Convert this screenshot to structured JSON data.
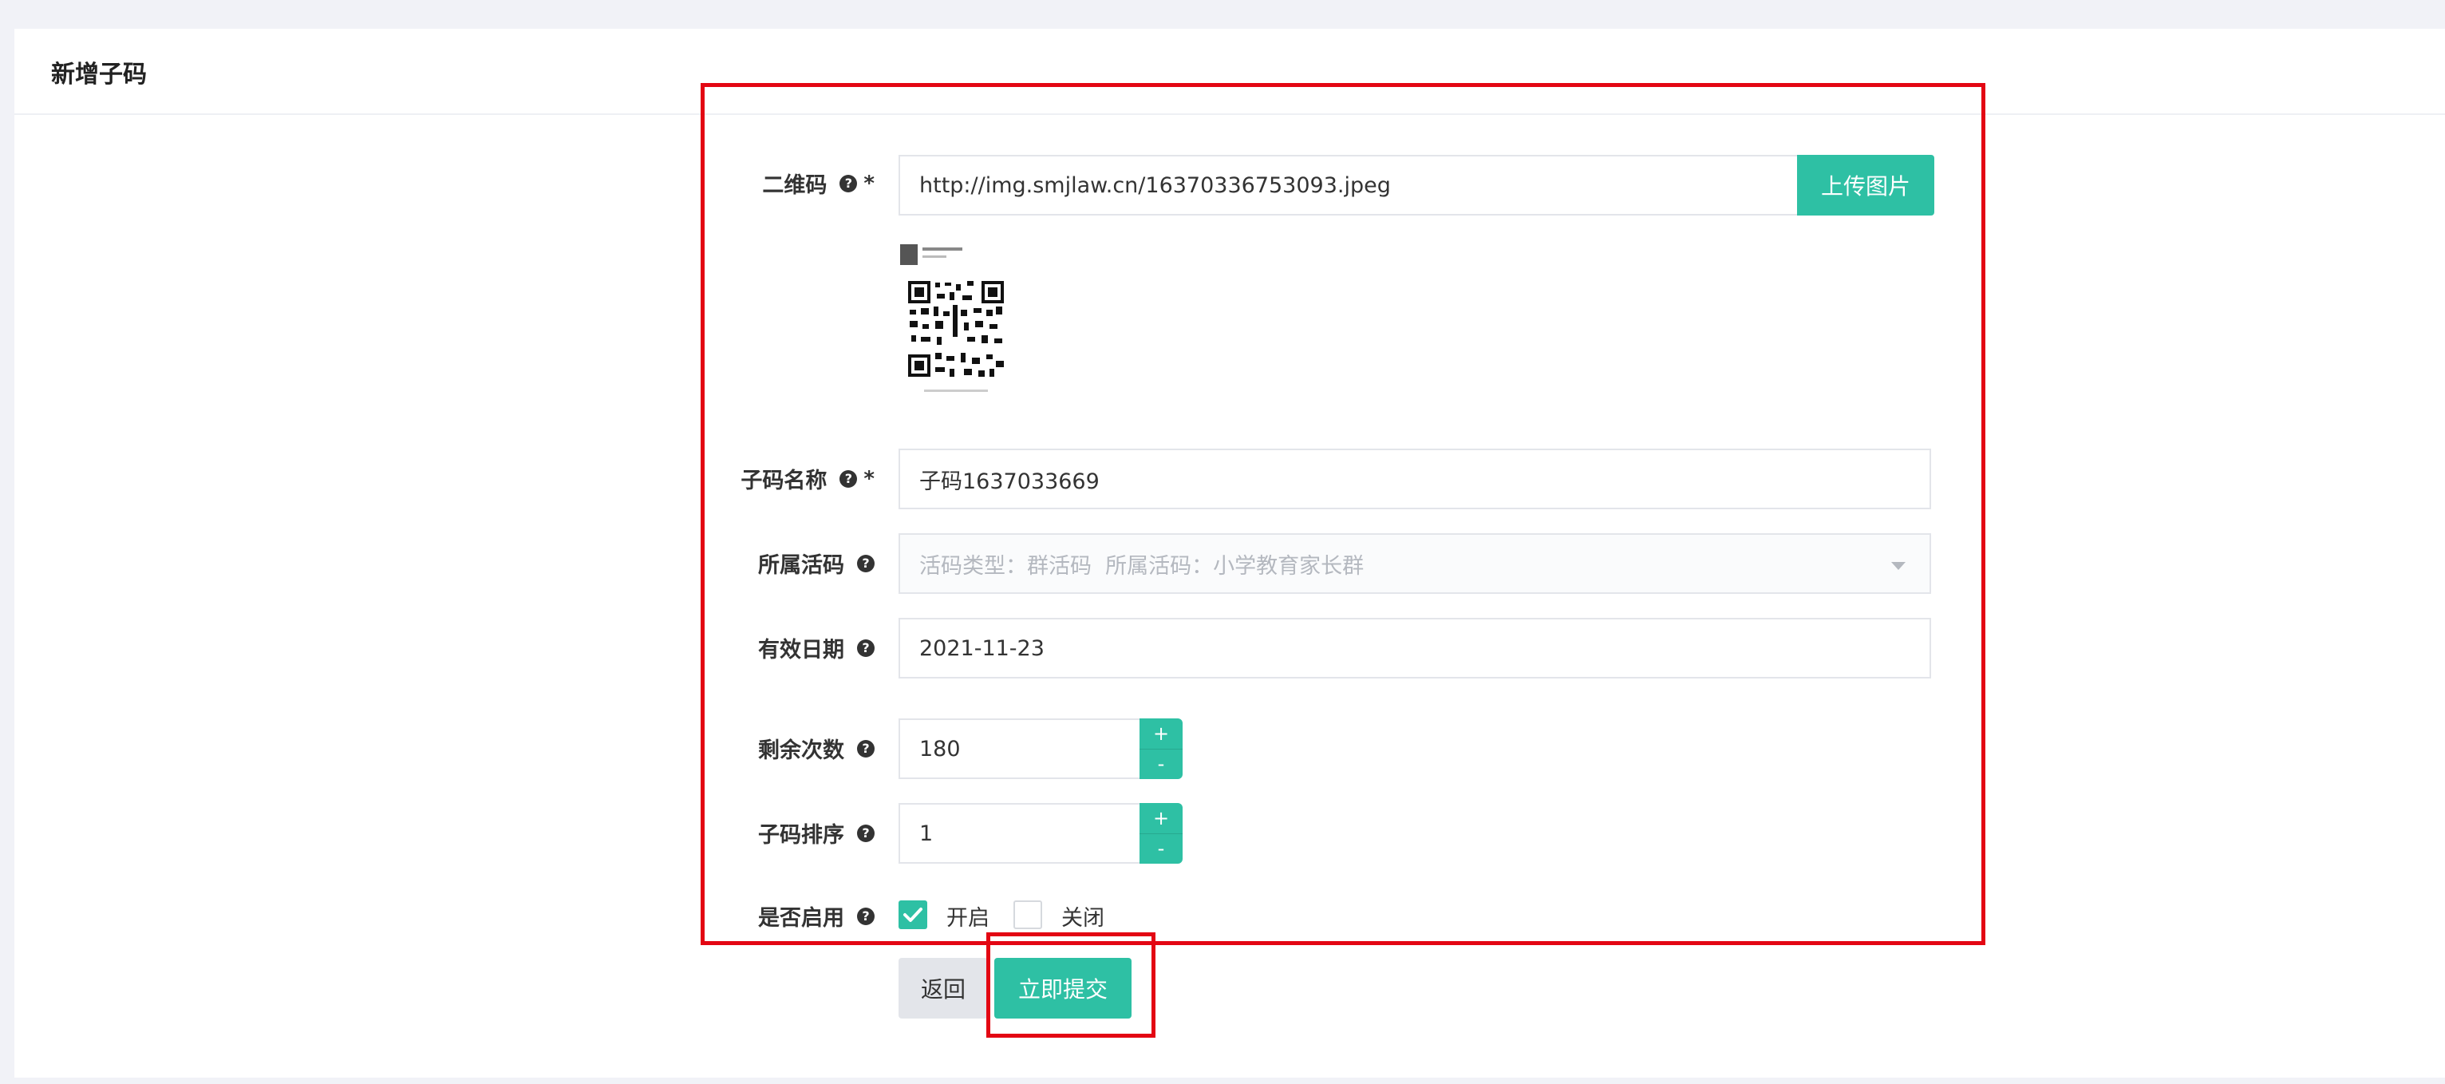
{
  "page": {
    "title": "新增子码"
  },
  "form": {
    "qrcode": {
      "label": "二维码",
      "help_icon": "question-circle-icon",
      "required_mark": "*",
      "value": "http://img.smjlaw.cn/16370336753093.jpeg",
      "upload_label": "上传图片"
    },
    "name": {
      "label": "子码名称",
      "required_mark": "*",
      "value": "子码1637033669"
    },
    "parent": {
      "label": "所属活码",
      "value": "活码类型：群活码  所属活码：小学教育家长群"
    },
    "expiry": {
      "label": "有效日期",
      "value": "2021-11-23"
    },
    "remaining": {
      "label": "剩余次数",
      "value": "180",
      "plus": "+",
      "minus": "-"
    },
    "sort": {
      "label": "子码排序",
      "value": "1",
      "plus": "+",
      "minus": "-"
    },
    "enabled": {
      "label": "是否启用",
      "on_label": "开启",
      "off_label": "关闭",
      "selected": "开启"
    }
  },
  "actions": {
    "back_label": "返回",
    "submit_label": "立即提交"
  },
  "colors": {
    "accent": "#2ec0a4",
    "annotation": "#e30613",
    "background": "#f1f2f7"
  }
}
